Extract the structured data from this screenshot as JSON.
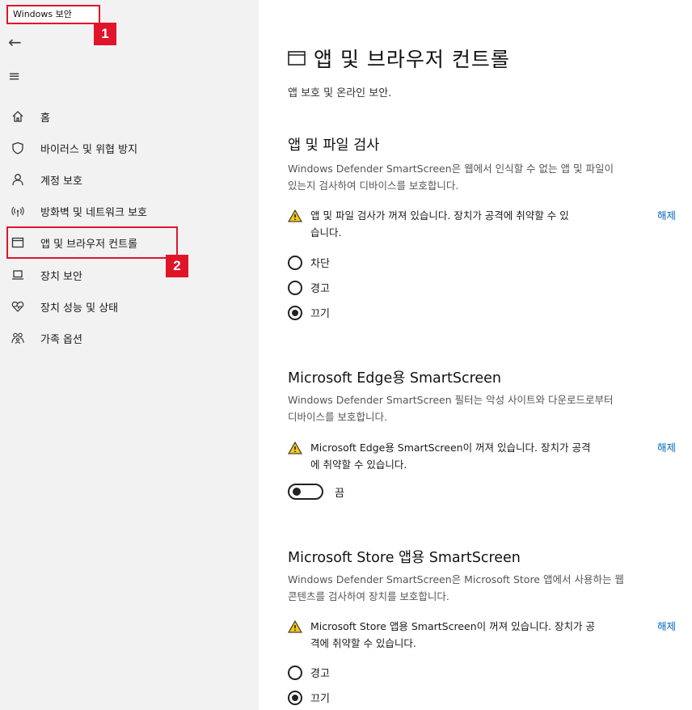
{
  "window": {
    "title": "Windows 보안"
  },
  "badges": {
    "one": "1",
    "two": "2"
  },
  "sidebar": {
    "back_glyph": "←",
    "menu_glyph": "≡",
    "items": [
      {
        "label": "홈",
        "icon": "home-icon"
      },
      {
        "label": "바이러스 및 위협 방지",
        "icon": "shield-icon"
      },
      {
        "label": "계정 보호",
        "icon": "person-icon"
      },
      {
        "label": "방화벽 및 네트워크 보호",
        "icon": "wifi-signal-icon"
      },
      {
        "label": "앱 및 브라우저 컨트롤",
        "icon": "app-window-icon"
      },
      {
        "label": "장치 보안",
        "icon": "laptop-icon"
      },
      {
        "label": "장치 성능 및 상태",
        "icon": "heart-icon"
      },
      {
        "label": "가족 옵션",
        "icon": "family-icon"
      }
    ]
  },
  "main": {
    "title": "앱 및 브라우저 컨트롤",
    "subtitle": "앱 보호 및 온라인 보안.",
    "sections": [
      {
        "heading": "앱 및 파일 검사",
        "desc_lines": [
          "Windows Defender SmartScreen은 웹에서 인식할 수 없는 앱 및 파일이",
          "있는지 검사하여 디바이스를 보호합니다."
        ],
        "warning_lines": [
          "앱 및 파일 검사가 꺼져 있습니다. 장치가 공격에 취약할 수 있",
          "습니다."
        ],
        "link": "해제",
        "options": [
          "차단",
          "경고",
          "끄기"
        ],
        "selected": "끄기"
      },
      {
        "heading": "Microsoft Edge용 SmartScreen",
        "desc_lines": [
          "Windows Defender SmartScreen 필터는 악성 사이트와 다운로드로부터",
          "디바이스를 보호합니다."
        ],
        "warning_lines": [
          "Microsoft Edge용 SmartScreen이 꺼져 있습니다. 장치가 공격",
          "에 취약할 수 있습니다."
        ],
        "link": "해제",
        "toggle_label": "끔"
      },
      {
        "heading": "Microsoft Store 앱용 SmartScreen",
        "desc_lines": [
          "Windows Defender SmartScreen은 Microsoft Store 앱에서 사용하는 웹",
          "콘텐츠를 검사하여 장치를 보호합니다."
        ],
        "warning_lines": [
          "Microsoft Store 앱용 SmartScreen이 꺼져 있습니다. 장치가 공",
          "격에 취약할 수 있습니다."
        ],
        "link": "해제",
        "options": [
          "경고",
          "끄기"
        ],
        "selected": "끄기"
      }
    ]
  },
  "colors": {
    "accent": "#0067c0",
    "highlight": "#e0152a",
    "warning": "#f5c518",
    "sidebar_bg": "#f2f2f2"
  }
}
